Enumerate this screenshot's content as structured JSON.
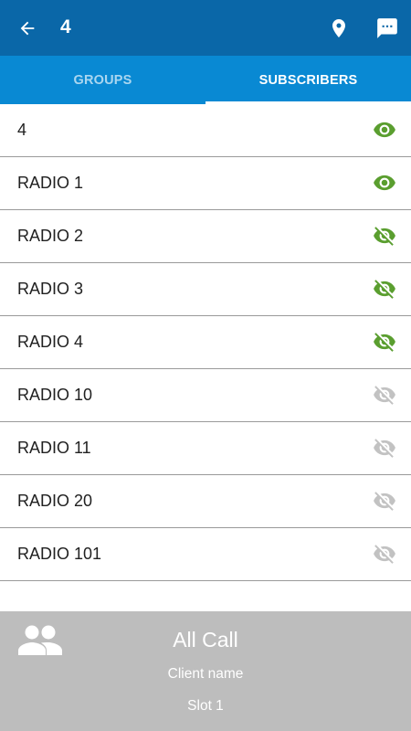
{
  "app_bar": {
    "title": "4",
    "back_icon": "arrow-back-icon",
    "location_icon": "location-pin-icon",
    "message_icon": "message-icon"
  },
  "tabs": [
    {
      "label": "GROUPS",
      "selected": false
    },
    {
      "label": "SUBSCRIBERS",
      "selected": true
    }
  ],
  "subscribers": [
    {
      "label": "4",
      "status_icon": "eye-icon",
      "visibility": "visible",
      "icon_color": "#5a9e2f"
    },
    {
      "label": "RADIO 1",
      "status_icon": "eye-icon",
      "visibility": "visible",
      "icon_color": "#5a9e2f"
    },
    {
      "label": "RADIO 2",
      "status_icon": "eye-off-icon",
      "visibility": "hidden",
      "icon_color": "#5a9e2f"
    },
    {
      "label": "RADIO 3",
      "status_icon": "eye-off-icon",
      "visibility": "hidden",
      "icon_color": "#5a9e2f"
    },
    {
      "label": "RADIO 4",
      "status_icon": "eye-off-icon",
      "visibility": "hidden",
      "icon_color": "#5a9e2f"
    },
    {
      "label": "RADIO 10",
      "status_icon": "eye-off-icon",
      "visibility": "hidden",
      "icon_color": "#c2c2c2"
    },
    {
      "label": "RADIO 11",
      "status_icon": "eye-off-icon",
      "visibility": "hidden",
      "icon_color": "#c2c2c2"
    },
    {
      "label": "RADIO 20",
      "status_icon": "eye-off-icon",
      "visibility": "hidden",
      "icon_color": "#c2c2c2"
    },
    {
      "label": "RADIO 101",
      "status_icon": "eye-off-icon",
      "visibility": "hidden",
      "icon_color": "#c2c2c2"
    }
  ],
  "footer": {
    "icon": "group-icon",
    "call_name": "All Call",
    "client_name": "Client name",
    "slot": "Slot 1"
  },
  "colors": {
    "app_bar": "#0a67a8",
    "tab_bar": "#0989d3",
    "footer": "#bdbdbd"
  }
}
